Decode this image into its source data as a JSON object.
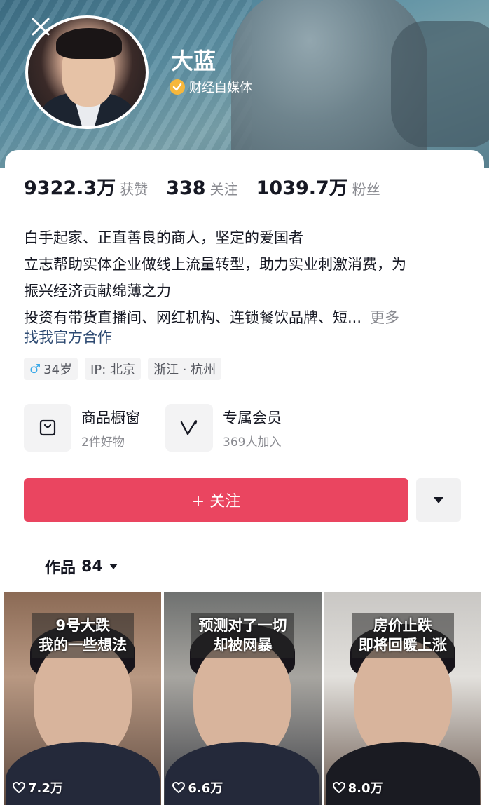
{
  "profile": {
    "name": "大蓝",
    "badge_text": "财经自媒体"
  },
  "stats": [
    {
      "value": "9322.3万",
      "label": "获赞"
    },
    {
      "value": "338",
      "label": "关注"
    },
    {
      "value": "1039.7万",
      "label": "粉丝"
    }
  ],
  "bio": {
    "line1": "白手起家、正直善良的商人，坚定的爱国者",
    "line2": "立志帮助实体企业做线上流量转型，助力实业刺激消费，为",
    "line3": "振兴经济贡献绵薄之力",
    "line4": "投资有带货直播间、网红机构、连锁餐饮品牌、短...",
    "more": "更多",
    "contact": "找我官方合作"
  },
  "tags": {
    "age_symbol": "♂",
    "age": "34岁",
    "ip": "IP: 北京",
    "location": "浙江 · 杭州"
  },
  "services": [
    {
      "title": "商品橱窗",
      "subtitle": "2件好物",
      "icon": "shop-window-icon"
    },
    {
      "title": "专属会员",
      "subtitle": "369人加入",
      "icon": "membership-icon"
    }
  ],
  "actions": {
    "follow_label": "+ 关注"
  },
  "works": {
    "label": "作品",
    "count": "84"
  },
  "videos": [
    {
      "caption1": "9号大跌",
      "caption2": "我的一些想法",
      "likes": "7.2万"
    },
    {
      "caption1": "预测对了一切",
      "caption2": "却被网暴",
      "likes": "6.6万"
    },
    {
      "caption1": "房价止跌",
      "caption2": "即将回暖上涨",
      "likes": "8.0万"
    }
  ],
  "colors": {
    "follow_button": "#ea4560",
    "link": "#2d4a72",
    "badge": "#f6b73c"
  }
}
